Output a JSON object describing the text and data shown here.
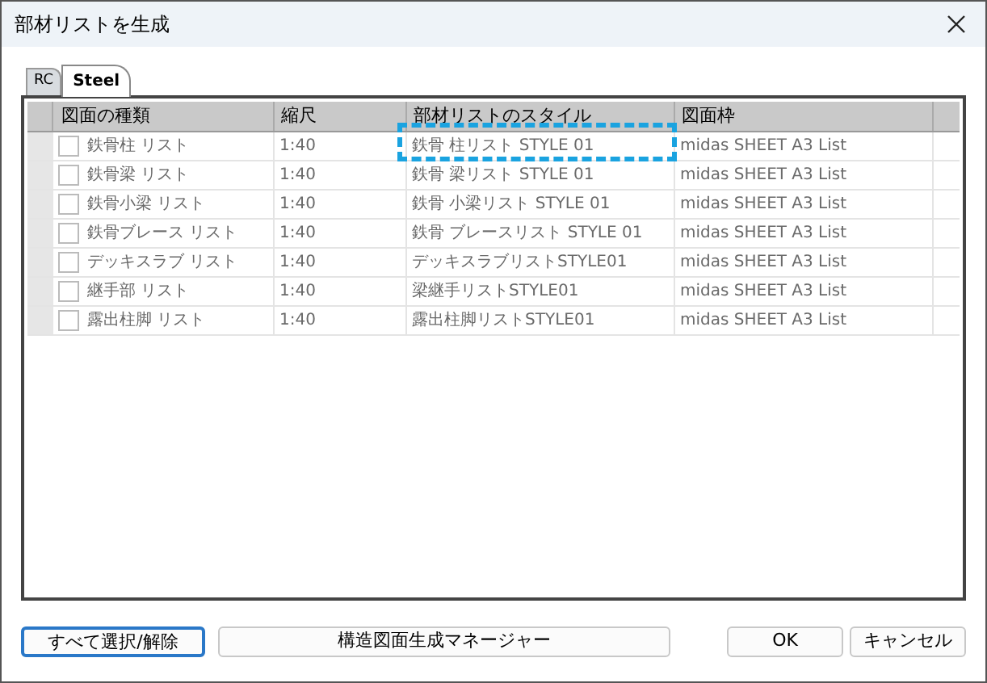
{
  "window": {
    "title": "部材リストを生成"
  },
  "tabs": [
    {
      "label": "RC",
      "selected": false
    },
    {
      "label": "Steel",
      "selected": true
    }
  ],
  "table": {
    "columns": [
      "図面の種類",
      "縮尺",
      "部材リストのスタイル",
      "図面枠"
    ],
    "rows": [
      {
        "checked": false,
        "cells": [
          "鉄骨柱 リスト",
          "1:40",
          "鉄骨 柱リスト STYLE 01",
          "midas SHEET A3 List"
        ],
        "highlighted": true
      },
      {
        "checked": false,
        "cells": [
          "鉄骨梁 リスト",
          "1:40",
          "鉄骨 梁リスト STYLE 01",
          "midas SHEET A3 List"
        ],
        "highlighted": false
      },
      {
        "checked": false,
        "cells": [
          "鉄骨小梁 リスト",
          "1:40",
          "鉄骨 小梁リスト STYLE 01",
          "midas SHEET A3 List"
        ],
        "highlighted": false
      },
      {
        "checked": false,
        "cells": [
          "鉄骨ブレース リスト",
          "1:40",
          "鉄骨 ブレースリスト STYLE 01",
          "midas SHEET A3 List"
        ],
        "highlighted": false
      },
      {
        "checked": false,
        "cells": [
          "デッキスラブ リスト",
          "1:40",
          "デッキスラブリストSTYLE01",
          "midas SHEET A3 List"
        ],
        "highlighted": false
      },
      {
        "checked": false,
        "cells": [
          "継手部 リスト",
          "1:40",
          "梁継手リストSTYLE01",
          "midas SHEET A3 List"
        ],
        "highlighted": false
      },
      {
        "checked": false,
        "cells": [
          "露出柱脚 リスト",
          "1:40",
          "露出柱脚リストSTYLE01",
          "midas SHEET A3 List"
        ],
        "highlighted": false
      }
    ]
  },
  "buttons": [
    {
      "label": "すべて選択/解除",
      "kind": "default"
    },
    {
      "label": "構造図面生成マネージャー",
      "kind": "wide"
    },
    {
      "label": "OK",
      "kind": "normal"
    },
    {
      "label": "キャンセル",
      "kind": "normal"
    }
  ]
}
